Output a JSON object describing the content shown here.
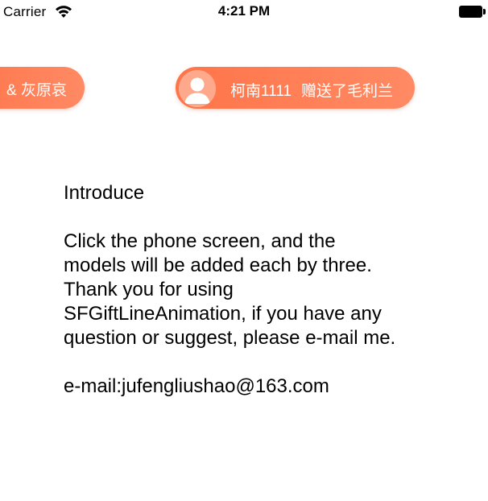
{
  "status_bar": {
    "carrier": "Carrier",
    "time": "4:21 PM",
    "wifi_icon": "wifi-icon",
    "battery_icon": "battery-icon",
    "battery_level": 1.0
  },
  "gifts": [
    {
      "text": "& 灰原哀"
    },
    {
      "sender": "柯南1111",
      "action": "赠送了毛利兰",
      "avatar_icon": "user-avatar-icon"
    }
  ],
  "accent_color": "#ff7a52",
  "intro": {
    "title": "Introduce",
    "body_lines": [
      "Click the phone screen, and the",
      "models will be added each by three.",
      "Thank you for using",
      "SFGiftLineAnimation, if you have any",
      "question or suggest, please e-mail me."
    ],
    "email": "e-mail:jufengliushao@163.com"
  }
}
